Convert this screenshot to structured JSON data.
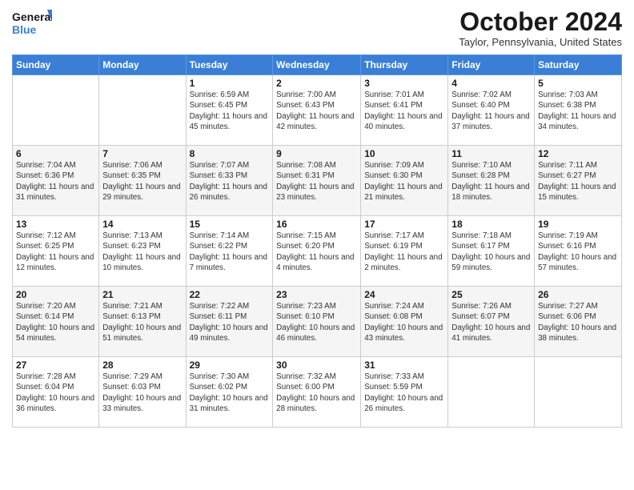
{
  "header": {
    "logo_general": "General",
    "logo_blue": "Blue",
    "month_year": "October 2024",
    "location": "Taylor, Pennsylvania, United States"
  },
  "days_of_week": [
    "Sunday",
    "Monday",
    "Tuesday",
    "Wednesday",
    "Thursday",
    "Friday",
    "Saturday"
  ],
  "weeks": [
    [
      {
        "day": "",
        "info": ""
      },
      {
        "day": "",
        "info": ""
      },
      {
        "day": "1",
        "info": "Sunrise: 6:59 AM\nSunset: 6:45 PM\nDaylight: 11 hours and 45 minutes."
      },
      {
        "day": "2",
        "info": "Sunrise: 7:00 AM\nSunset: 6:43 PM\nDaylight: 11 hours and 42 minutes."
      },
      {
        "day": "3",
        "info": "Sunrise: 7:01 AM\nSunset: 6:41 PM\nDaylight: 11 hours and 40 minutes."
      },
      {
        "day": "4",
        "info": "Sunrise: 7:02 AM\nSunset: 6:40 PM\nDaylight: 11 hours and 37 minutes."
      },
      {
        "day": "5",
        "info": "Sunrise: 7:03 AM\nSunset: 6:38 PM\nDaylight: 11 hours and 34 minutes."
      }
    ],
    [
      {
        "day": "6",
        "info": "Sunrise: 7:04 AM\nSunset: 6:36 PM\nDaylight: 11 hours and 31 minutes."
      },
      {
        "day": "7",
        "info": "Sunrise: 7:06 AM\nSunset: 6:35 PM\nDaylight: 11 hours and 29 minutes."
      },
      {
        "day": "8",
        "info": "Sunrise: 7:07 AM\nSunset: 6:33 PM\nDaylight: 11 hours and 26 minutes."
      },
      {
        "day": "9",
        "info": "Sunrise: 7:08 AM\nSunset: 6:31 PM\nDaylight: 11 hours and 23 minutes."
      },
      {
        "day": "10",
        "info": "Sunrise: 7:09 AM\nSunset: 6:30 PM\nDaylight: 11 hours and 21 minutes."
      },
      {
        "day": "11",
        "info": "Sunrise: 7:10 AM\nSunset: 6:28 PM\nDaylight: 11 hours and 18 minutes."
      },
      {
        "day": "12",
        "info": "Sunrise: 7:11 AM\nSunset: 6:27 PM\nDaylight: 11 hours and 15 minutes."
      }
    ],
    [
      {
        "day": "13",
        "info": "Sunrise: 7:12 AM\nSunset: 6:25 PM\nDaylight: 11 hours and 12 minutes."
      },
      {
        "day": "14",
        "info": "Sunrise: 7:13 AM\nSunset: 6:23 PM\nDaylight: 11 hours and 10 minutes."
      },
      {
        "day": "15",
        "info": "Sunrise: 7:14 AM\nSunset: 6:22 PM\nDaylight: 11 hours and 7 minutes."
      },
      {
        "day": "16",
        "info": "Sunrise: 7:15 AM\nSunset: 6:20 PM\nDaylight: 11 hours and 4 minutes."
      },
      {
        "day": "17",
        "info": "Sunrise: 7:17 AM\nSunset: 6:19 PM\nDaylight: 11 hours and 2 minutes."
      },
      {
        "day": "18",
        "info": "Sunrise: 7:18 AM\nSunset: 6:17 PM\nDaylight: 10 hours and 59 minutes."
      },
      {
        "day": "19",
        "info": "Sunrise: 7:19 AM\nSunset: 6:16 PM\nDaylight: 10 hours and 57 minutes."
      }
    ],
    [
      {
        "day": "20",
        "info": "Sunrise: 7:20 AM\nSunset: 6:14 PM\nDaylight: 10 hours and 54 minutes."
      },
      {
        "day": "21",
        "info": "Sunrise: 7:21 AM\nSunset: 6:13 PM\nDaylight: 10 hours and 51 minutes."
      },
      {
        "day": "22",
        "info": "Sunrise: 7:22 AM\nSunset: 6:11 PM\nDaylight: 10 hours and 49 minutes."
      },
      {
        "day": "23",
        "info": "Sunrise: 7:23 AM\nSunset: 6:10 PM\nDaylight: 10 hours and 46 minutes."
      },
      {
        "day": "24",
        "info": "Sunrise: 7:24 AM\nSunset: 6:08 PM\nDaylight: 10 hours and 43 minutes."
      },
      {
        "day": "25",
        "info": "Sunrise: 7:26 AM\nSunset: 6:07 PM\nDaylight: 10 hours and 41 minutes."
      },
      {
        "day": "26",
        "info": "Sunrise: 7:27 AM\nSunset: 6:06 PM\nDaylight: 10 hours and 38 minutes."
      }
    ],
    [
      {
        "day": "27",
        "info": "Sunrise: 7:28 AM\nSunset: 6:04 PM\nDaylight: 10 hours and 36 minutes."
      },
      {
        "day": "28",
        "info": "Sunrise: 7:29 AM\nSunset: 6:03 PM\nDaylight: 10 hours and 33 minutes."
      },
      {
        "day": "29",
        "info": "Sunrise: 7:30 AM\nSunset: 6:02 PM\nDaylight: 10 hours and 31 minutes."
      },
      {
        "day": "30",
        "info": "Sunrise: 7:32 AM\nSunset: 6:00 PM\nDaylight: 10 hours and 28 minutes."
      },
      {
        "day": "31",
        "info": "Sunrise: 7:33 AM\nSunset: 5:59 PM\nDaylight: 10 hours and 26 minutes."
      },
      {
        "day": "",
        "info": ""
      },
      {
        "day": "",
        "info": ""
      }
    ]
  ]
}
